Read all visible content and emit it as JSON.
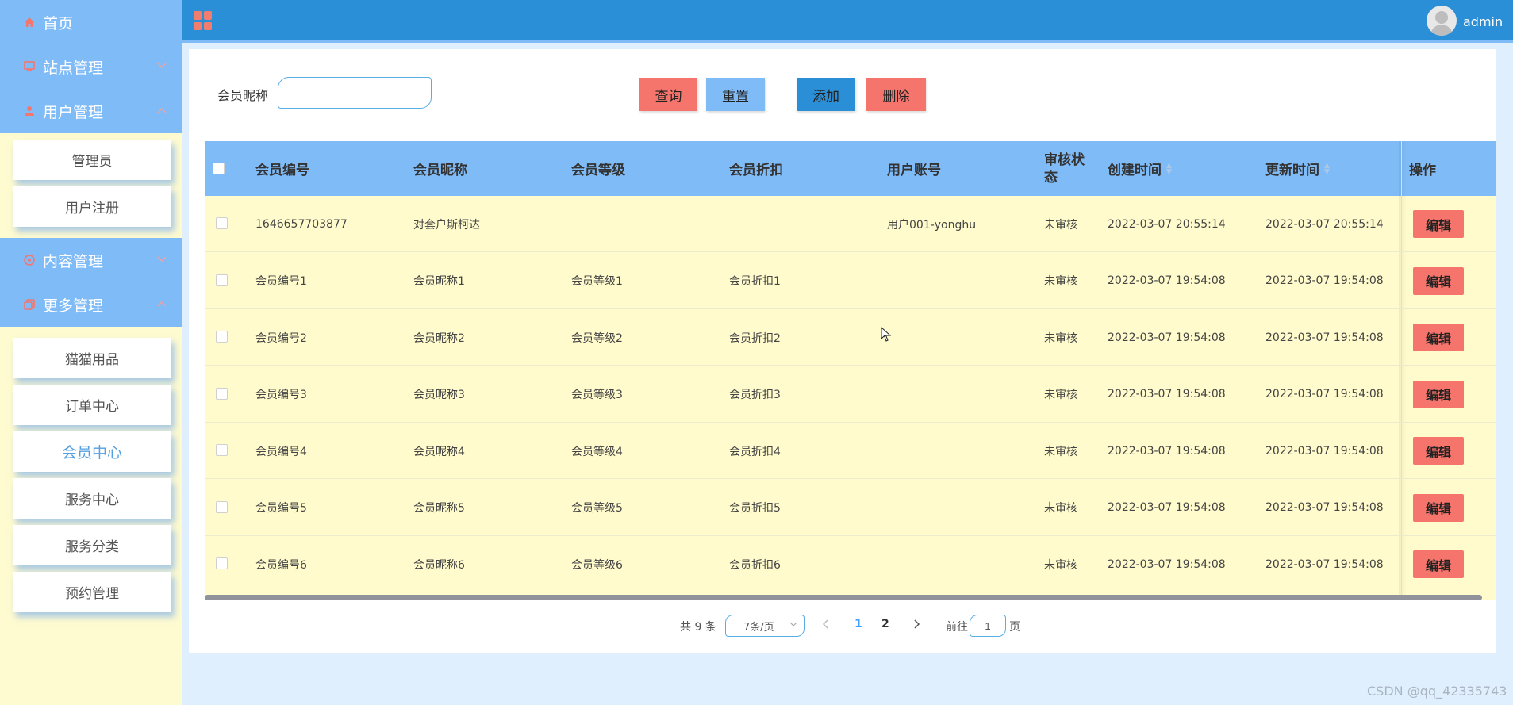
{
  "sidebar": {
    "home": "首页",
    "site_mgmt": "站点管理",
    "user_mgmt": "用户管理",
    "user_sub": [
      "管理员",
      "用户注册"
    ],
    "content_mgmt": "内容管理",
    "more_mgmt": "更多管理",
    "more_sub": [
      "猫猫用品",
      "订单中心",
      "会员中心",
      "服务中心",
      "服务分类",
      "预约管理"
    ]
  },
  "header": {
    "username": "admin"
  },
  "search": {
    "label": "会员昵称",
    "value": "",
    "placeholder": ""
  },
  "toolbar": {
    "query": "查询",
    "reset": "重置",
    "add": "添加",
    "delete": "删除"
  },
  "table": {
    "columns": [
      "会员编号",
      "会员昵称",
      "会员等级",
      "会员折扣",
      "用户账号",
      "审核状态",
      "创建时间",
      "更新时间",
      "操作"
    ],
    "rows": [
      [
        "1646657703877",
        "对套户斯柯达",
        "",
        "",
        "用户001-yonghu",
        "未审核",
        "2022-03-07 20:55:14",
        "2022-03-07 20:55:14"
      ],
      [
        "会员编号1",
        "会员昵称1",
        "会员等级1",
        "会员折扣1",
        "",
        "未审核",
        "2022-03-07 19:54:08",
        "2022-03-07 19:54:08"
      ],
      [
        "会员编号2",
        "会员昵称2",
        "会员等级2",
        "会员折扣2",
        "",
        "未审核",
        "2022-03-07 19:54:08",
        "2022-03-07 19:54:08"
      ],
      [
        "会员编号3",
        "会员昵称3",
        "会员等级3",
        "会员折扣3",
        "",
        "未审核",
        "2022-03-07 19:54:08",
        "2022-03-07 19:54:08"
      ],
      [
        "会员编号4",
        "会员昵称4",
        "会员等级4",
        "会员折扣4",
        "",
        "未审核",
        "2022-03-07 19:54:08",
        "2022-03-07 19:54:08"
      ],
      [
        "会员编号5",
        "会员昵称5",
        "会员等级5",
        "会员折扣5",
        "",
        "未审核",
        "2022-03-07 19:54:08",
        "2022-03-07 19:54:08"
      ],
      [
        "会员编号6",
        "会员昵称6",
        "会员等级6",
        "会员折扣6",
        "",
        "未审核",
        "2022-03-07 19:54:08",
        "2022-03-07 19:54:08"
      ]
    ],
    "edit_label": "编辑"
  },
  "pagination": {
    "total_text": "共 9 条",
    "page_size": "7条/页",
    "pages": [
      "1",
      "2"
    ],
    "current": "1",
    "goto_prefix": "前往",
    "goto_value": "1",
    "goto_suffix": "页"
  },
  "watermark": "CSDN @qq_42335743",
  "colors": {
    "topbar": "#2a8fd6",
    "sidebar_menu": "#7fbbf7",
    "sidebar_bg": "#fffbd0",
    "danger": "#f5756c",
    "table_bg": "#fffbcc"
  },
  "icons": [
    "home-icon",
    "monitor-icon",
    "user-icon",
    "target-icon",
    "copy-icon",
    "grid-menu-icon",
    "chevron-down-icon",
    "chevron-up-icon",
    "avatar-icon"
  ]
}
